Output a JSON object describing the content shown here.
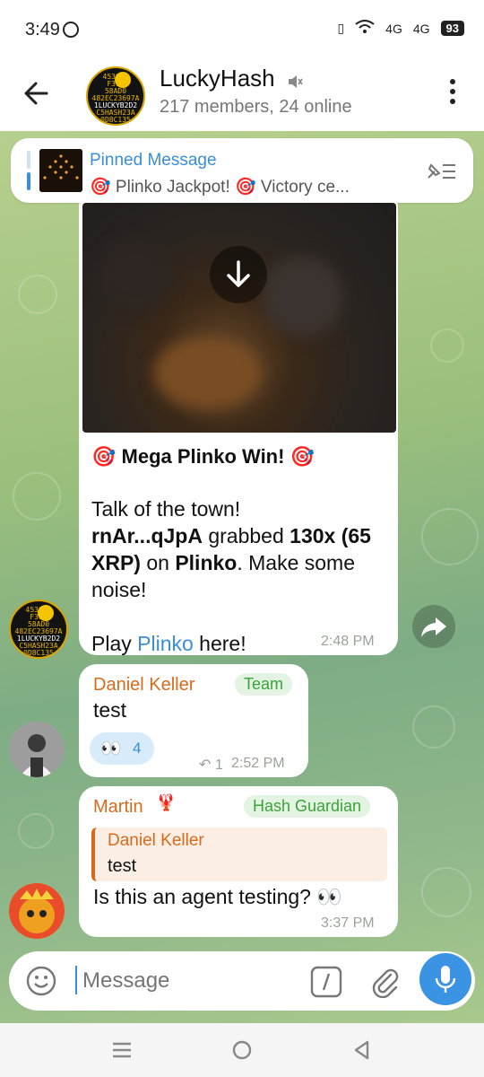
{
  "status_bar": {
    "time": "3:49",
    "battery": "93",
    "signal1": "4G",
    "signal2": "4G"
  },
  "header": {
    "title": "LuckyHash",
    "subtitle": "217 members, 24 online",
    "avatar_lines": [
      "4530E4",
      "F315",
      "58AD0",
      "482EC23697A",
      "1LUCKYB2D2",
      "C5HASH23A",
      "0D8C135"
    ]
  },
  "pinned": {
    "title": "Pinned Message",
    "text": "🎯 Plinko Jackpot! 🎯  Victory ce..."
  },
  "messages": [
    {
      "title": "Mega Plinko Win!",
      "line1": "Talk of the town!",
      "user": "rnAr...qJpA",
      "grabbed": " grabbed ",
      "amount": "130x (65 XRP)",
      "on": " on ",
      "game": "Plinko",
      "tail": ". Make some noise!",
      "play_prefix": "Play ",
      "play_link": "Plinko",
      "play_suffix": " here!",
      "time": "2:48 PM"
    },
    {
      "sender": "Daniel Keller",
      "tag": "Team",
      "text": "test",
      "reaction_count": "4",
      "replies": "1",
      "time": "2:52 PM"
    },
    {
      "sender": "Martin",
      "tag": "Hash Guardian",
      "quote_sender": "Daniel Keller",
      "quote_text": "test",
      "text": "Is this an agent testing? 👀",
      "time": "3:37 PM"
    }
  ],
  "input": {
    "placeholder": "Message"
  },
  "colors": {
    "accent": "#3a8ed8",
    "sender": "#d86a1c",
    "tag_green": "#3ca23b"
  }
}
